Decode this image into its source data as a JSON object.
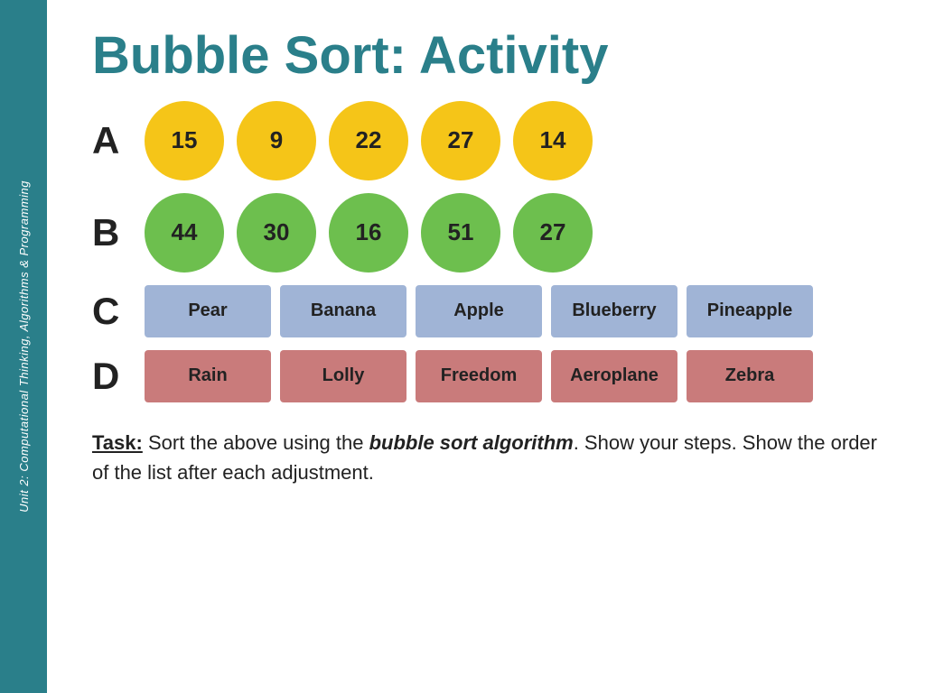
{
  "sidebar": {
    "text": "Unit 2: Computational Thinking, Algorithms & Programming"
  },
  "header": {
    "title": "Bubble Sort: Activity"
  },
  "rows": {
    "A": {
      "label": "A",
      "items": [
        "15",
        "9",
        "22",
        "27",
        "14"
      ],
      "type": "circle-yellow"
    },
    "B": {
      "label": "B",
      "items": [
        "44",
        "30",
        "16",
        "51",
        "27"
      ],
      "type": "circle-green"
    },
    "C": {
      "label": "C",
      "items": [
        "Pear",
        "Banana",
        "Apple",
        "Blueberry",
        "Pineapple"
      ],
      "type": "box-blue"
    },
    "D": {
      "label": "D",
      "items": [
        "Rain",
        "Lolly",
        "Freedom",
        "Aeroplane",
        "Zebra"
      ],
      "type": "box-red"
    }
  },
  "task": {
    "prefix": "Task:",
    "text1": " Sort the above using the ",
    "highlight": "bubble sort algorithm",
    "text2": ". Show your steps. Show the order of the list after each adjustment."
  }
}
